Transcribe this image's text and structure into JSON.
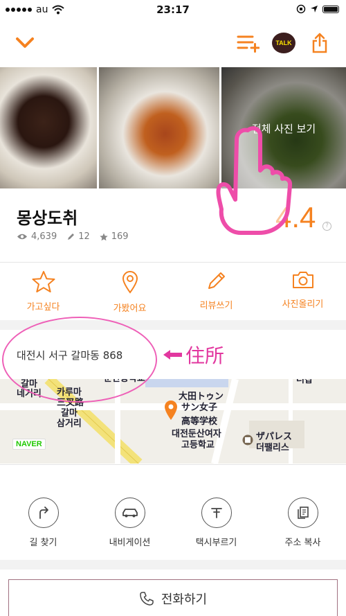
{
  "status_bar": {
    "carrier": "au",
    "time": "23:17"
  },
  "toolbar": {
    "talk_label": "TALK"
  },
  "photos": {
    "view_all": "전체 사진 보기"
  },
  "restaurant": {
    "name": "몽상도취",
    "views": "4,639",
    "reviews": "12",
    "favorites": "169",
    "score": "4.4"
  },
  "actions": [
    {
      "label": "가고싶다",
      "icon": "star-icon"
    },
    {
      "label": "가봤어요",
      "icon": "location-pin-icon"
    },
    {
      "label": "리뷰쓰기",
      "icon": "pencil-icon"
    },
    {
      "label": "사진올리기",
      "icon": "camera-icon"
    }
  ],
  "address": {
    "text": "대전시 서구 갈마동 868",
    "annotation": "住所"
  },
  "map": {
    "labels": [
      "갈마",
      "네거리",
      "카루마",
      "三叉路",
      "갈마",
      "삼거리",
      "문산중학교",
      "大田トゥン",
      "サン女子",
      "高等学校",
      "대전둔산여자",
      "고등학교",
      "ザパレス",
      "더팰리스",
      "더샵"
    ],
    "provider": "NAVER"
  },
  "bottom_actions": [
    {
      "label": "길 찾기",
      "icon": "directions-icon"
    },
    {
      "label": "내비게이션",
      "icon": "car-icon"
    },
    {
      "label": "택시부르기",
      "icon": "taxi-icon"
    },
    {
      "label": "주소 복사",
      "icon": "copy-icon"
    }
  ],
  "call": {
    "label": "전화하기"
  },
  "colors": {
    "accent": "#f58220",
    "annotation": "#e2379f"
  }
}
